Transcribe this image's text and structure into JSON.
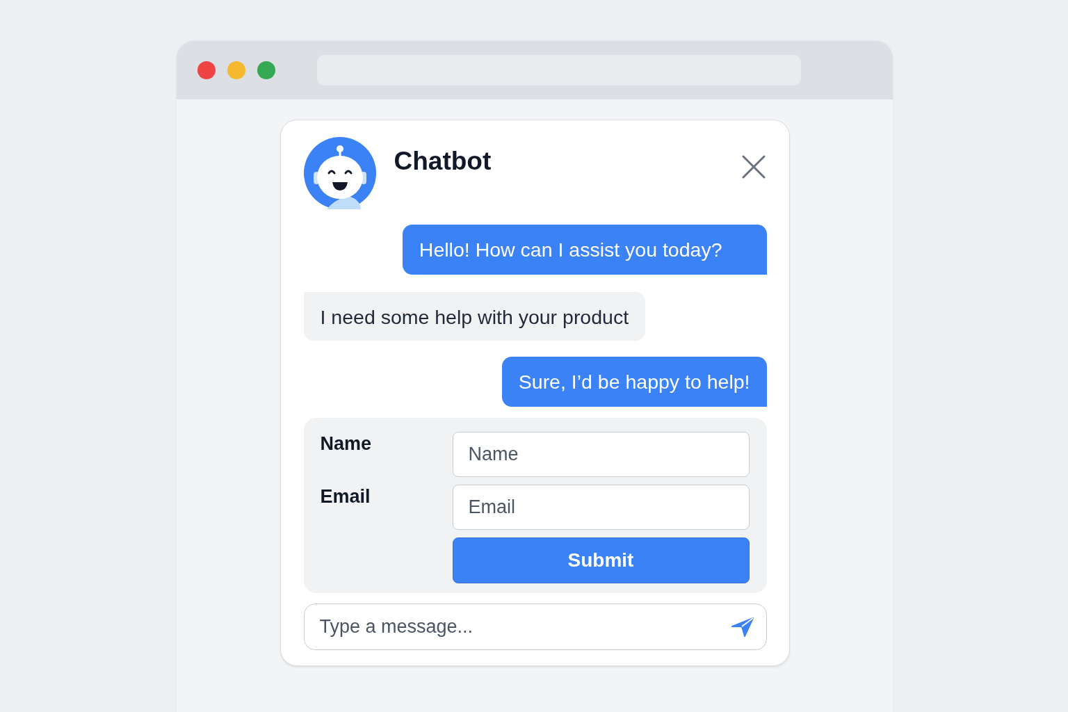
{
  "browser": {
    "traffic_lights": [
      {
        "color": "#ef4444"
      },
      {
        "color": "#f5b82e"
      },
      {
        "color": "#34a853"
      }
    ]
  },
  "chat": {
    "title": "Chatbot",
    "messages": [
      {
        "kind": "outgoing",
        "text": "Hello! How can I assist you today?"
      },
      {
        "kind": "incoming",
        "text": "I need some help with your product"
      },
      {
        "kind": "outgoing",
        "text": "Sure, I’d be happy to help!"
      }
    ],
    "form": {
      "fields": [
        {
          "label": "Name",
          "placeholder": "Name"
        },
        {
          "label": "Email",
          "placeholder": "Email"
        }
      ],
      "submit": "Submit"
    },
    "composer": {
      "placeholder": "Type a message..."
    }
  }
}
